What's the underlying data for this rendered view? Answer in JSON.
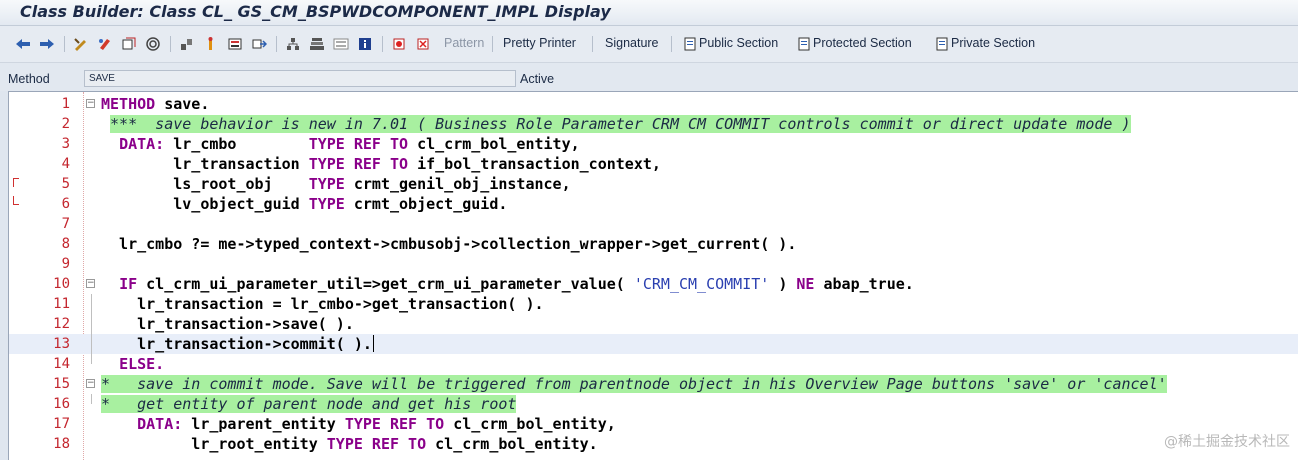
{
  "window": {
    "title": "Class Builder: Class CL_ GS_CM_BSPWDCOMPONENT_IMPL Display"
  },
  "toolbar": {
    "icons": [
      "back-arrow-icon",
      "forward-arrow-icon",
      "toggle-edit-icon",
      "change-display-icon",
      "check-icon",
      "activate-icon",
      "test-icon",
      "where-used-icon",
      "hierarchy-icon",
      "object-list-icon",
      "navigate-icon",
      "display-object-list-icon",
      "enhancement-icon",
      "info-icon",
      "breakpoint-icon",
      "delete-breakpoint-icon"
    ],
    "pattern": "Pattern",
    "pretty_printer": "Pretty Printer",
    "signature": "Signature",
    "public_section": "Public Section",
    "protected_section": "Protected Section",
    "private_section": "Private Section"
  },
  "method_bar": {
    "label": "Method",
    "value": "SAVE",
    "status": "Active"
  },
  "editor": {
    "lines": [
      {
        "n": "1",
        "fold": "minus"
      },
      {
        "n": "2"
      },
      {
        "n": "3"
      },
      {
        "n": "4"
      },
      {
        "n": "5",
        "marker": true
      },
      {
        "n": "6",
        "marker": true
      },
      {
        "n": "7"
      },
      {
        "n": "8"
      },
      {
        "n": "9"
      },
      {
        "n": "10",
        "fold": "minus"
      },
      {
        "n": "11"
      },
      {
        "n": "12"
      },
      {
        "n": "13"
      },
      {
        "n": "14"
      },
      {
        "n": "15",
        "fold": "minus"
      },
      {
        "n": "16"
      },
      {
        "n": "17"
      },
      {
        "n": "18"
      }
    ],
    "code": {
      "l1_kw": "METHOD",
      "l1_rest": " save.",
      "l2_comment": "***  save behavior is new in 7.01 ( Business Role Parameter CRM CM COMMIT controls commit or direct update mode )",
      "l3_kw": "DATA:",
      "l3_a": " lr_cmbo        ",
      "l3_kw2": "TYPE REF TO",
      "l3_b": " cl_crm_bol_entity,",
      "l4_a": "        lr_transaction ",
      "l4_kw": "TYPE REF TO",
      "l4_b": " if_bol_transaction_context,",
      "l5_a": "        ls_root_obj    ",
      "l5_kw": "TYPE",
      "l5_b": " crmt_genil_obj_instance,",
      "l6_a": "        lv_object_guid ",
      "l6_kw": "TYPE",
      "l6_b": " crmt_object_guid.",
      "l8": "  lr_cmbo ?= me->typed_context->cmbusobj->collection_wrapper->get_current( ).",
      "l10_kw": "IF",
      "l10_a": " cl_crm_ui_parameter_util=>get_crm_ui_parameter_value( ",
      "l10_str": "'CRM_CM_COMMIT'",
      "l10_b": " ) ",
      "l10_kw2": "NE",
      "l10_c": " abap_true.",
      "l11": "    lr_transaction = lr_cmbo->get_transaction( ).",
      "l12": "    lr_transaction->save( ).",
      "l13": "    lr_transaction->commit( ).",
      "l14_kw": "ELSE.",
      "l15_comment": "*   save in commit mode. Save will be triggered from parentnode object in his Overview Page buttons 'save' or 'cancel'",
      "l16_comment": "*   get entity of parent node and get his root",
      "l17_kw": "DATA:",
      "l17_a": " lr_parent_entity ",
      "l17_kw2": "TYPE REF TO",
      "l17_b": " cl_crm_bol_entity,",
      "l18_a": "          lr_root_entity ",
      "l18_kw": "TYPE REF TO",
      "l18_b": " cl_crm_bol_entity."
    }
  },
  "watermark": "@稀土掘金技术社区"
}
